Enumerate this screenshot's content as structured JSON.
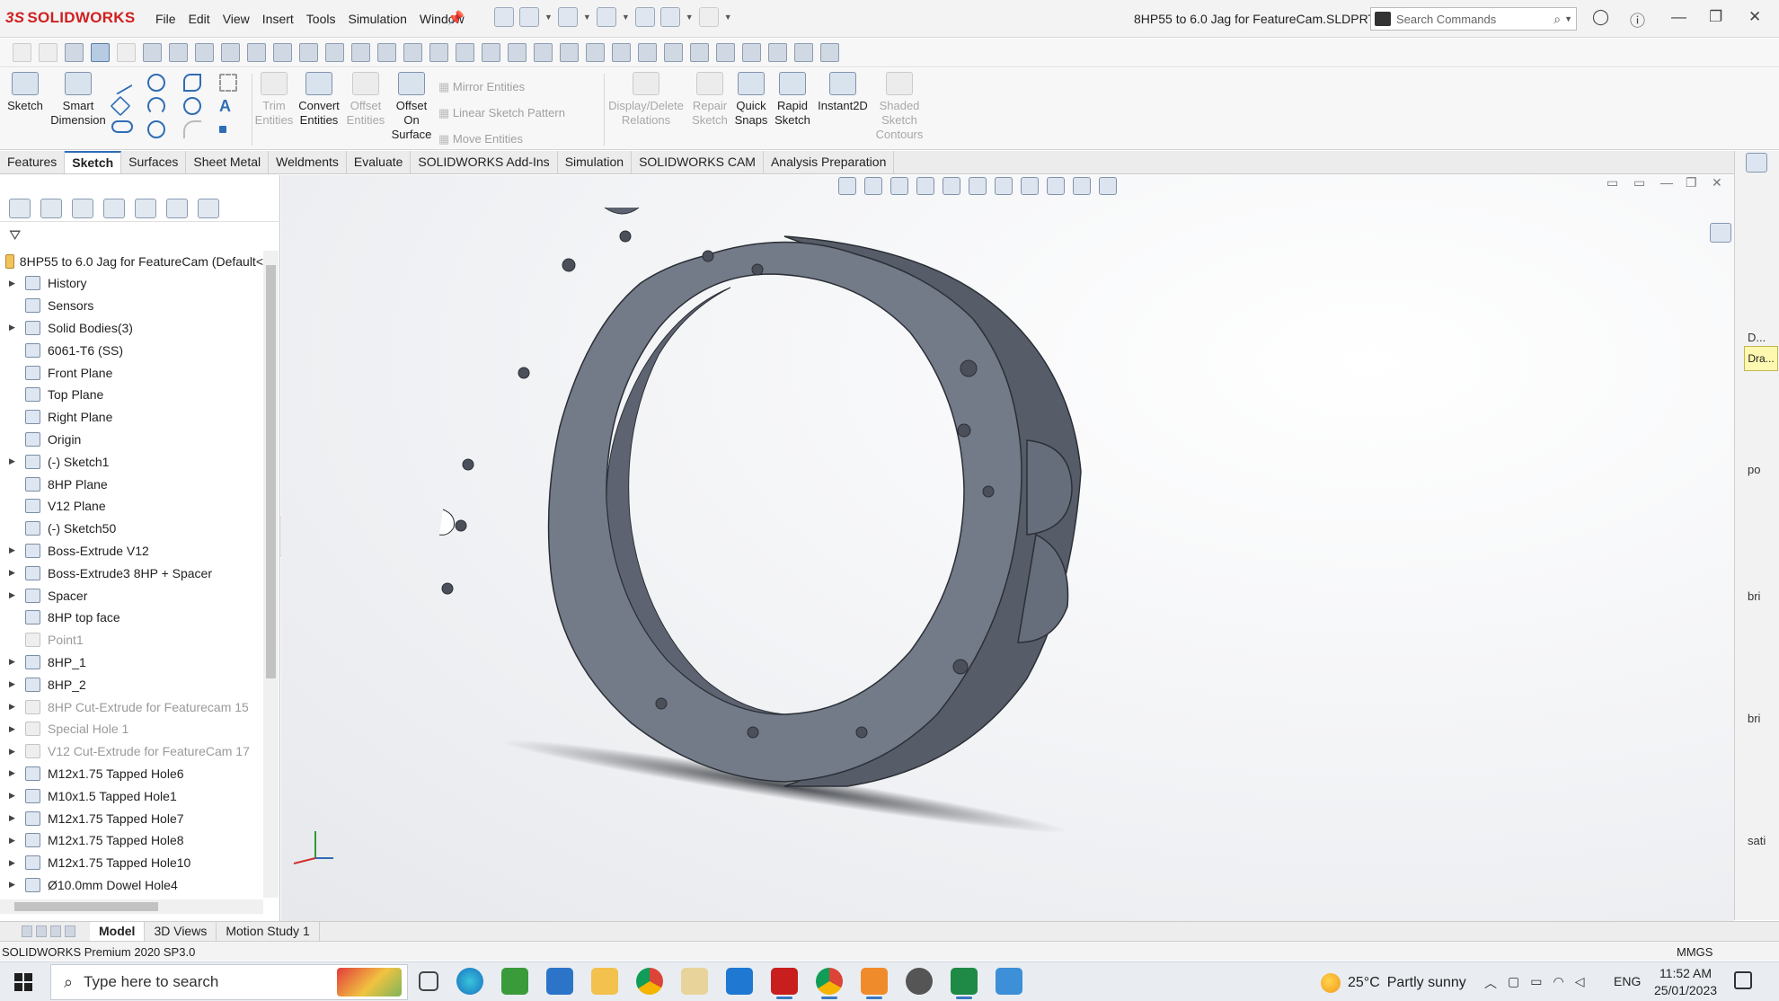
{
  "app": {
    "logo_prefix": "3S",
    "logo_text": "SOLIDWORKS",
    "menu": [
      "File",
      "Edit",
      "View",
      "Insert",
      "Tools",
      "Simulation",
      "Window"
    ],
    "document_title": "8HP55 to 6.0 Jag for FeatureCam.SLDPRT *",
    "search_placeholder": "Search Commands"
  },
  "command_manager": {
    "sketch": "Sketch",
    "smart_dimension": [
      "Smart",
      "Dimension"
    ],
    "trim_entities": [
      "Trim",
      "Entities"
    ],
    "convert_entities": [
      "Convert",
      "Entities"
    ],
    "offset_entities": [
      "Offset",
      "Entities"
    ],
    "offset_on_surface": [
      "Offset",
      "On",
      "Surface"
    ],
    "mirror_entities": "Mirror Entities",
    "linear_sketch_pattern": "Linear Sketch Pattern",
    "move_entities": "Move Entities",
    "display_delete_relations": [
      "Display/Delete",
      "Relations"
    ],
    "repair_sketch": [
      "Repair",
      "Sketch"
    ],
    "quick_snaps": [
      "Quick",
      "Snaps"
    ],
    "rapid_sketch": [
      "Rapid",
      "Sketch"
    ],
    "instant2d": "Instant2D",
    "shaded_sketch_contours": [
      "Shaded",
      "Sketch",
      "Contours"
    ]
  },
  "tabs": [
    "Features",
    "Sketch",
    "Surfaces",
    "Sheet Metal",
    "Weldments",
    "Evaluate",
    "SOLIDWORKS Add-Ins",
    "Simulation",
    "SOLIDWORKS CAM",
    "Analysis Preparation"
  ],
  "active_tab": "Sketch",
  "tree": {
    "root": "8HP55 to 6.0 Jag for FeatureCam  (Default<",
    "items": [
      {
        "label": "History",
        "expand": true,
        "dim": false
      },
      {
        "label": "Sensors",
        "expand": false,
        "dim": false
      },
      {
        "label": "Solid Bodies(3)",
        "expand": true,
        "dim": false
      },
      {
        "label": "6061-T6 (SS)",
        "expand": false,
        "dim": false
      },
      {
        "label": "Front Plane",
        "expand": false,
        "dim": false
      },
      {
        "label": "Top Plane",
        "expand": false,
        "dim": false
      },
      {
        "label": "Right Plane",
        "expand": false,
        "dim": false
      },
      {
        "label": "Origin",
        "expand": false,
        "dim": false
      },
      {
        "label": "(-) Sketch1",
        "expand": true,
        "dim": false
      },
      {
        "label": "8HP Plane",
        "expand": false,
        "dim": false
      },
      {
        "label": "V12 Plane",
        "expand": false,
        "dim": false
      },
      {
        "label": "(-) Sketch50",
        "expand": false,
        "dim": false
      },
      {
        "label": "Boss-Extrude V12",
        "expand": true,
        "dim": false
      },
      {
        "label": "Boss-Extrude3 8HP + Spacer",
        "expand": true,
        "dim": false
      },
      {
        "label": "Spacer",
        "expand": true,
        "dim": false
      },
      {
        "label": "8HP top face",
        "expand": false,
        "dim": false
      },
      {
        "label": "Point1",
        "expand": false,
        "dim": true
      },
      {
        "label": "8HP_1",
        "expand": true,
        "dim": false
      },
      {
        "label": "8HP_2",
        "expand": true,
        "dim": false
      },
      {
        "label": "8HP Cut-Extrude for Featurecam 15",
        "expand": true,
        "dim": true
      },
      {
        "label": "Special Hole 1",
        "expand": true,
        "dim": true
      },
      {
        "label": "V12 Cut-Extrude for FeatureCam 17",
        "expand": true,
        "dim": true
      },
      {
        "label": "M12x1.75 Tapped Hole6",
        "expand": true,
        "dim": false
      },
      {
        "label": "M10x1.5 Tapped Hole1",
        "expand": true,
        "dim": false
      },
      {
        "label": "M12x1.75 Tapped Hole7",
        "expand": true,
        "dim": false
      },
      {
        "label": "M12x1.75 Tapped Hole8",
        "expand": true,
        "dim": false
      },
      {
        "label": "M12x1.75 Tapped Hole10",
        "expand": true,
        "dim": false
      },
      {
        "label": "Ø10.0mm Dowel Hole4",
        "expand": true,
        "dim": false
      }
    ]
  },
  "taskpane": {
    "d_label": "D...",
    "dra_label": "Dra...",
    "side_words": [
      "po",
      "bri",
      "bri",
      "sati"
    ]
  },
  "bottom_tabs": [
    "Model",
    "3D Views",
    "Motion Study 1"
  ],
  "active_bottom_tab": "Model",
  "status": {
    "left": "SOLIDWORKS Premium 2020 SP3.0",
    "units": "MMGS"
  },
  "taskbar": {
    "search_placeholder": "Type here to search",
    "weather_temp": "25°C",
    "weather_desc": "Partly sunny",
    "language": "ENG",
    "time": "11:52 AM",
    "date": "25/01/2023"
  },
  "colors": {
    "part_fill": "#6f7685",
    "part_edge": "#2b2f36",
    "accent": "#2f6db5",
    "brand": "#d02020"
  }
}
